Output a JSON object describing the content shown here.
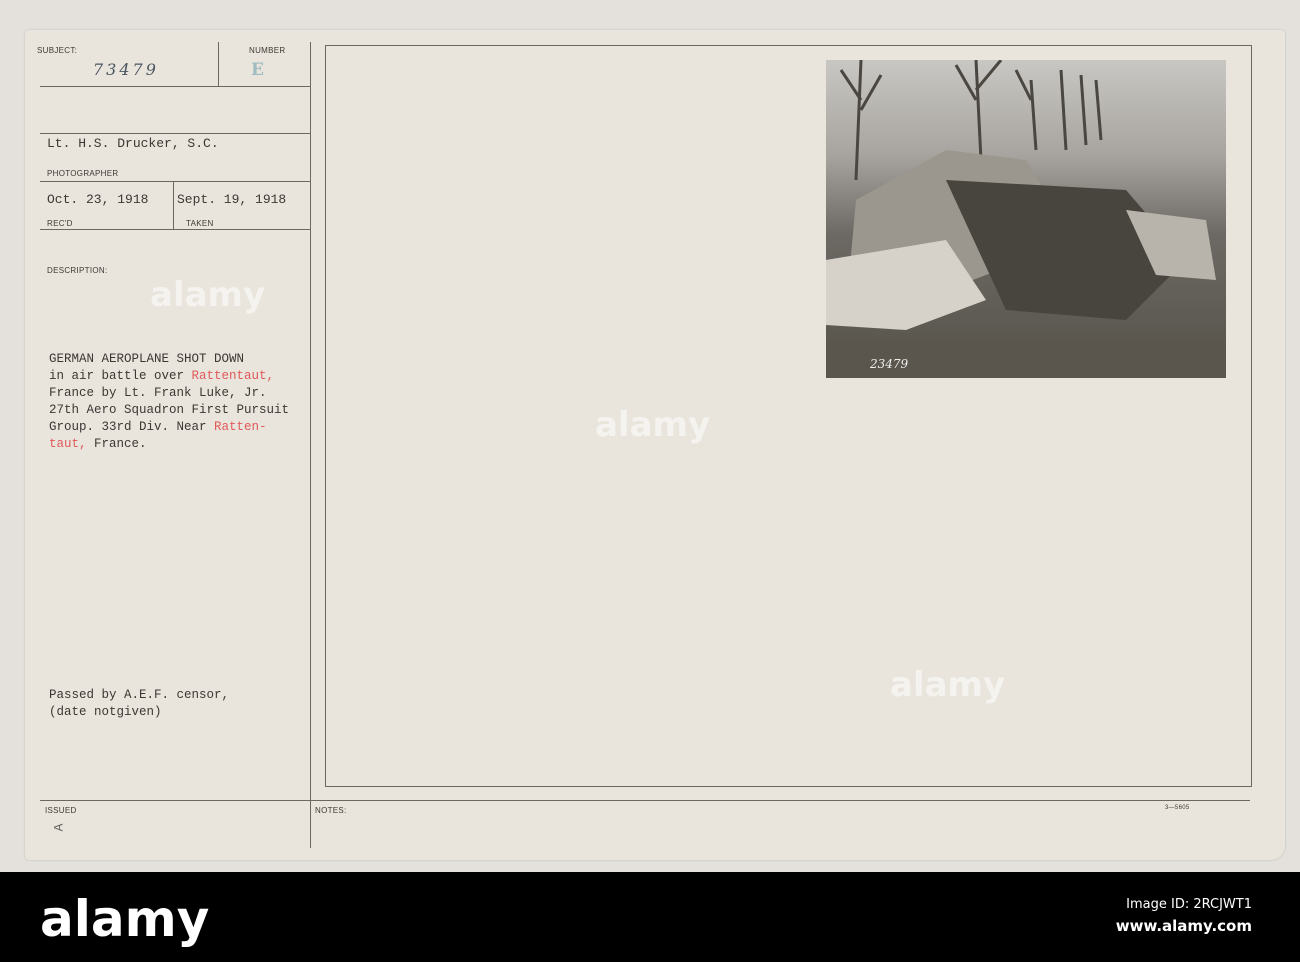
{
  "card": {
    "subject_label": "SUBJECT:",
    "subject_value": "73479",
    "number_label": "NUMBER",
    "number_value": "E",
    "photographer_value": "Lt. H.S. Drucker, S.C.",
    "photographer_label": "PHOTOGRAPHER",
    "received_value": "Oct. 23, 1918",
    "received_label": "REC'D",
    "taken_value": "Sept. 19, 1918",
    "taken_label": "TAKEN",
    "description_label": "DESCRIPTION:",
    "description_lines": [
      [
        "GERMAN AEROPLANE SHOT DOWN",
        ""
      ],
      [
        "in air battle over ",
        "Rattentaut,"
      ],
      [
        "France by Lt. Frank Luke, Jr.",
        ""
      ],
      [
        "27th Aero Squadron First Pursuit",
        ""
      ],
      [
        "Group. 33rd Div. Near ",
        "Ratten-"
      ],
      [
        "",
        "taut,",
        " France."
      ]
    ],
    "censor_lines": [
      "Passed by A.E.F. censor,",
      "(date notgiven)"
    ],
    "issued_label": "ISSUED",
    "issued_value": "A",
    "notes_label": "NOTES:",
    "form_number": "3—5605",
    "photo_stamp_number": "23479"
  },
  "watermark": {
    "text": "alamy",
    "image_id": "Image ID: 2RCJWT1",
    "url": "www.alamy.com"
  },
  "colors": {
    "card": "#e9e4dc",
    "typed_red": "#e05a5a",
    "footer": "#000000"
  }
}
